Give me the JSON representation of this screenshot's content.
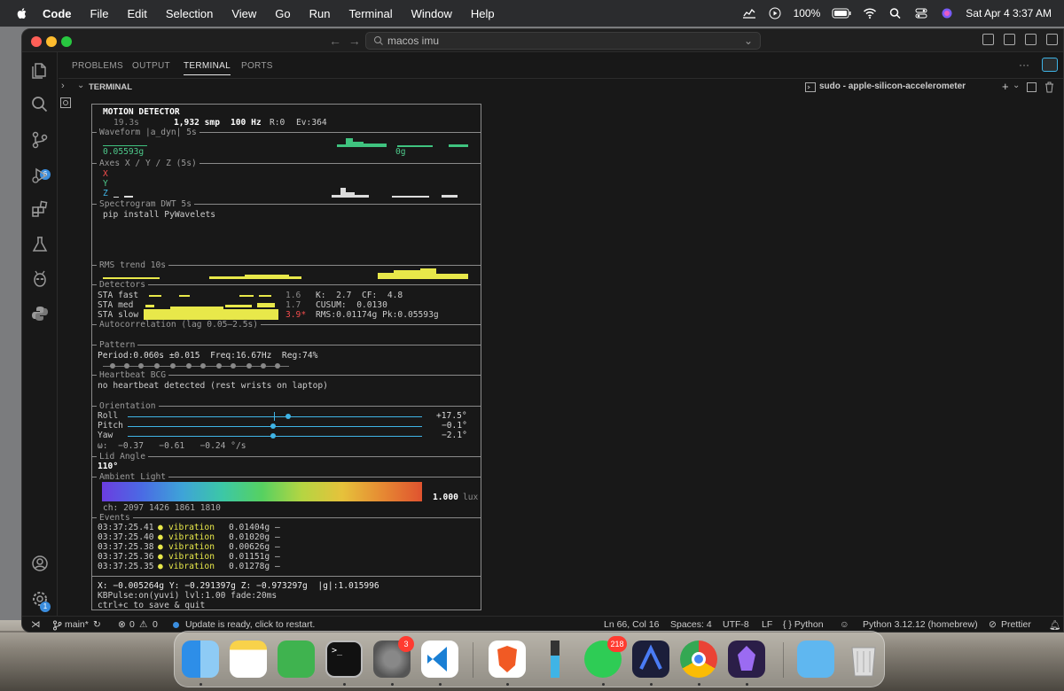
{
  "menubar": {
    "app": "Code",
    "items": [
      "File",
      "Edit",
      "Selection",
      "View",
      "Go",
      "Run",
      "Terminal",
      "Window",
      "Help"
    ],
    "battery": "100%",
    "datetime": "Sat Apr 4  3:37 AM"
  },
  "window": {
    "search": "macos imu"
  },
  "panel": {
    "tabs": [
      "PROBLEMS",
      "OUTPUT",
      "TERMINAL",
      "PORTS"
    ],
    "active": "TERMINAL",
    "section": "TERMINAL",
    "process": "sudo - apple-silicon-accelerometer"
  },
  "activity": {
    "scm_badge": "6",
    "account_badge": "1"
  },
  "monitor": {
    "title": "MOTION DETECTOR",
    "stats": {
      "time": "19.3s",
      "samples": "1,932 smp",
      "rate": "100 Hz",
      "r": "R:0",
      "events": "Ev:364"
    },
    "waveform": {
      "label": "Waveform |a_dyn| 5s",
      "peak": "0.05593g",
      "zero": "0g"
    },
    "axes": {
      "label": "Axes X / Y / Z (5s)",
      "x": "X",
      "y": "Y",
      "z": "Z"
    },
    "spectrogram": {
      "label": "Spectrogram DWT 5s",
      "note": "pip install PyWavelets"
    },
    "rms": {
      "label": "RMS trend 10s"
    },
    "detectors": {
      "label": "Detectors",
      "fast": "STA fast",
      "med": "STA med",
      "slow": "STA slow",
      "v_fast": "1.6",
      "v_med": "1.7",
      "v_slow": "3.9*",
      "k": "K:  2.7  CF:  4.8",
      "cusum": "CUSUM:  0.0130",
      "rms": "RMS:0.01174g Pk:0.05593g"
    },
    "autocorr": {
      "label": "Autocorrelation (lag 0.05–2.5s)"
    },
    "pattern": {
      "label": "Pattern",
      "text": "Period:0.060s ±0.015  Freq:16.67Hz  Reg:74%"
    },
    "heartbeat": {
      "label": "Heartbeat BCG",
      "text": "no heartbeat detected (rest wrists on laptop)"
    },
    "orientation": {
      "label": "Orientation",
      "roll": "Roll",
      "pitch": "Pitch",
      "yaw": "Yaw",
      "roll_v": "+17.5°",
      "pitch_v": "−0.1°",
      "yaw_v": "−2.1°",
      "omega": "ω:  −0.37   −0.61   −0.24 °/s"
    },
    "lid": {
      "label": "Lid Angle",
      "value": "110°"
    },
    "ambient": {
      "label": "Ambient Light",
      "value": "1.000",
      "unit": "lux",
      "channels": "ch: 2097 1426 1861 1810"
    },
    "events": {
      "label": "Events",
      "rows": [
        {
          "time": "03:37:25.41",
          "type": "vibration",
          "mag": "0.01404g –"
        },
        {
          "time": "03:37:25.40",
          "type": "vibration",
          "mag": "0.01020g –"
        },
        {
          "time": "03:37:25.38",
          "type": "vibration",
          "mag": "0.00626g –"
        },
        {
          "time": "03:37:25.36",
          "type": "vibration",
          "mag": "0.01151g –"
        },
        {
          "time": "03:37:25.35",
          "type": "vibration",
          "mag": "0.01278g –"
        }
      ]
    },
    "footer": {
      "xyz": "X: −0.005264g Y: −0.291397g Z: −0.973297g  |g|:1.015996",
      "kb": "KBPulse:on(yuvi) lvl:1.00 fade:20ms",
      "quit": "ctrl+c to save & quit"
    }
  },
  "statusbar": {
    "branch": "main*",
    "problems": "0",
    "warnings": "0",
    "update": "Update is ready, click to restart.",
    "position": "Ln 66, Col 16",
    "spaces": "Spaces: 4",
    "encoding": "UTF-8",
    "eol": "LF",
    "lang": "{ } Python",
    "python": "Python 3.12.12 (homebrew)",
    "prettier": "Prettier"
  },
  "dock": {
    "settings_badge": "3",
    "whatsapp_badge": "218"
  }
}
